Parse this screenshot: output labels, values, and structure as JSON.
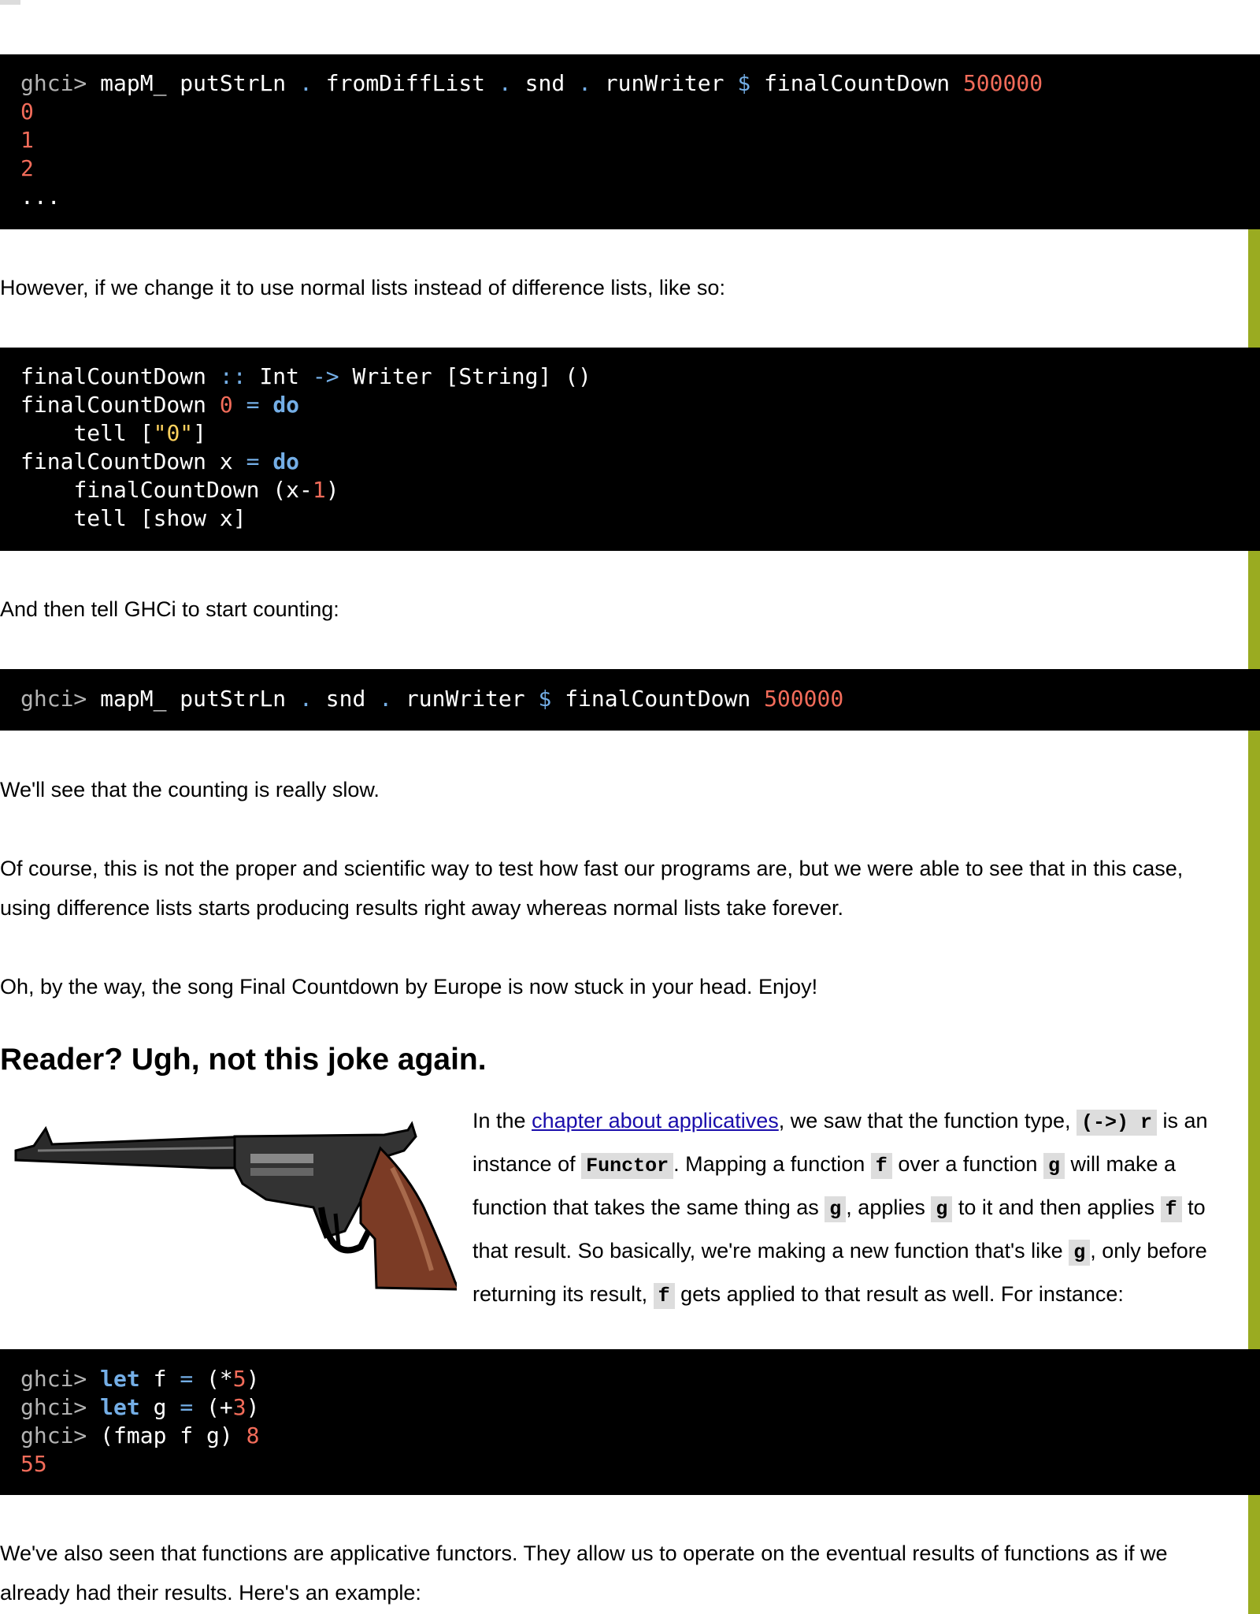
{
  "code1": {
    "prompt": "ghci>",
    "t1": "mapM_ putStrLn",
    "dot": ".",
    "t2": "fromDiffList",
    "t3": "snd",
    "t4": "runWriter",
    "dollar": "$",
    "t5": "finalCountDown",
    "n1": "500000",
    "out0": "0",
    "out1": "1",
    "out2": "2",
    "ellipsis": "..."
  },
  "para1": "However, if we change it to use normal lists instead of difference lists, like so:",
  "code2": {
    "name": "finalCountDown",
    "dcolon": "::",
    "int": "Int",
    "arrow": "->",
    "writer": "Writer [String] ()",
    "zero": "0",
    "eq": "=",
    "do": "do",
    "tell": "tell [",
    "str0": "\"0\"",
    "close": "]",
    "x": "x",
    "rec_open": "finalCountDown (x-",
    "one": "1",
    "rec_close": ")",
    "tell2": "tell [show x]"
  },
  "para2": "And then tell GHCi to start counting:",
  "code3": {
    "prompt": "ghci>",
    "t1": "mapM_ putStrLn",
    "dot": ".",
    "t2": "snd",
    "t3": "runWriter",
    "dollar": "$",
    "t4": "finalCountDown",
    "n1": "500000"
  },
  "para3": "We'll see that the counting is really slow.",
  "para4": "Of course, this is not the proper and scientific way to test how fast our programs are, but we were able to see that in this case, using difference lists starts producing results right away whereas normal lists take forever.",
  "para5": "Oh, by the way, the song Final Countdown by Europe is now stuck in your head. Enjoy!",
  "heading": "Reader? Ugh, not this joke again.",
  "side": {
    "s1": "In the ",
    "link": "chapter about applicatives",
    "s2": ", we saw that the function type, ",
    "c1": "(->) r",
    "s3": " is an instance of ",
    "c2": "Functor",
    "s4": ". Mapping a function ",
    "f": "f",
    "s5": " over a function ",
    "g": "g",
    "s6": " will make a function that takes the same thing as ",
    "s7": ", applies ",
    "s8": " to it and then applies ",
    "s9": " to that result. So basically, we're making a new function that's like ",
    "s10": ", only before returning its result, ",
    "s11": " gets applied to that result as well. For instance:"
  },
  "code4": {
    "prompt": "ghci>",
    "let": "let",
    "f": "f",
    "g": "g",
    "eq": "=",
    "open_mul": "(*",
    "five": "5",
    "rp": ")",
    "open_add": "(+",
    "three": "3",
    "fmap": "(fmap f g)",
    "eight": "8",
    "res": "55"
  },
  "para6": "We've also seen that functions are applicative functors. They allow us to operate on the eventual results of functions as if we already had their results. Here's an example:",
  "colors": {
    "accent_bar": "#9aab21",
    "code_bg": "#000000",
    "number": "#f26c5a",
    "operator": "#74aee6",
    "string": "#ffd25e",
    "link": "#1a0dab"
  },
  "image": "revolver-illustration"
}
